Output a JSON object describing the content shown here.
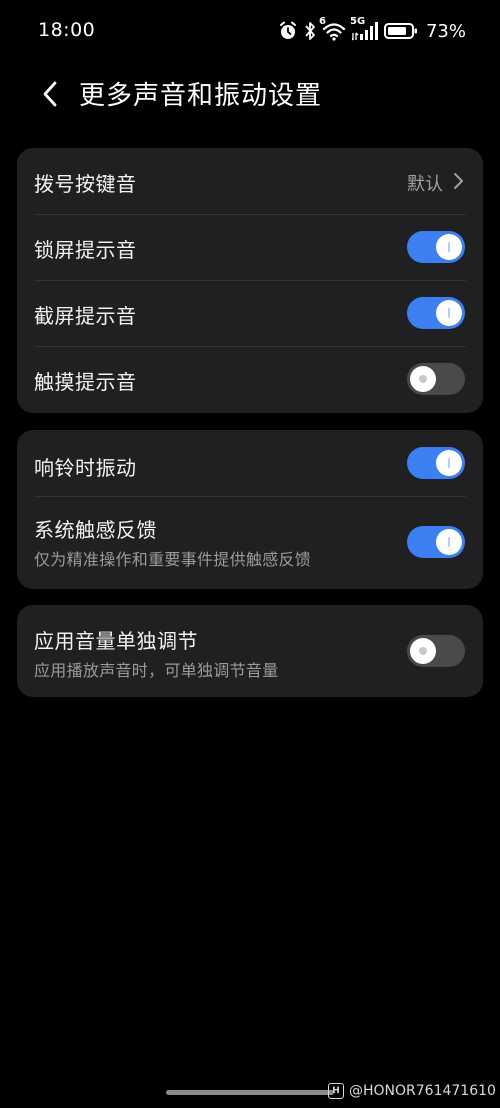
{
  "status_bar": {
    "time": "18:00",
    "battery_percent": "73%",
    "network_label": "5G",
    "wifi_label": "6",
    "icons": [
      "alarm-icon",
      "bluetooth-icon",
      "wifi-icon",
      "signal-icon",
      "battery-icon"
    ]
  },
  "header": {
    "title": "更多声音和振动设置"
  },
  "group1": {
    "rows": [
      {
        "label": "拨号按键音",
        "value": "默认"
      },
      {
        "label": "锁屏提示音",
        "toggle": true
      },
      {
        "label": "截屏提示音",
        "toggle": true
      },
      {
        "label": "触摸提示音",
        "toggle": false
      }
    ]
  },
  "group2": {
    "rows": [
      {
        "label": "响铃时振动",
        "toggle": true
      },
      {
        "label": "系统触感反馈",
        "subtitle": "仅为精准操作和重要事件提供触感反馈",
        "toggle": true
      }
    ]
  },
  "group3": {
    "rows": [
      {
        "label": "应用音量单独调节",
        "subtitle": "应用播放声音时，可单独调节音量",
        "toggle": false
      }
    ]
  },
  "watermark": {
    "text": "@HONOR761471610"
  },
  "colors": {
    "background": "#000000",
    "card": "#202022",
    "toggle_on": "#3b7ff0",
    "toggle_off": "#4a4a4c"
  }
}
